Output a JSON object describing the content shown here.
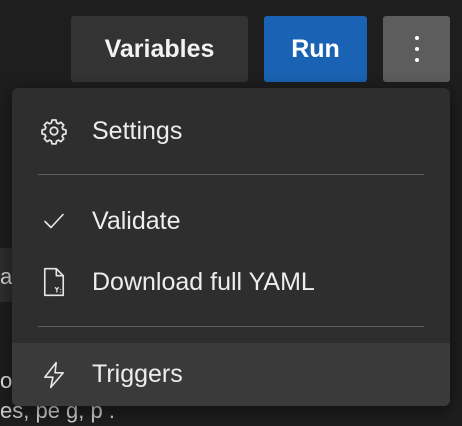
{
  "toolbar": {
    "variables_label": "Variables",
    "run_label": "Run",
    "more_icon": "more-vertical-icon"
  },
  "menu": {
    "items": [
      {
        "label": "Settings",
        "icon": "gear-icon"
      },
      {
        "label": "Validate",
        "icon": "check-icon"
      },
      {
        "label": "Download full YAML",
        "icon": "file-yaml-icon"
      },
      {
        "label": "Triggers",
        "icon": "lightning-bolt-icon"
      }
    ]
  },
  "background": {
    "left_fragment": "a",
    "bottom_fragment_1": "o",
    "bottom_fragment_2": "es, pe    g, p      ."
  },
  "colors": {
    "run_button": "#1a63b4",
    "menu_background": "#2e2e2e",
    "hover_item": "#3a3a3a",
    "more_button": "#5d5d5d"
  }
}
